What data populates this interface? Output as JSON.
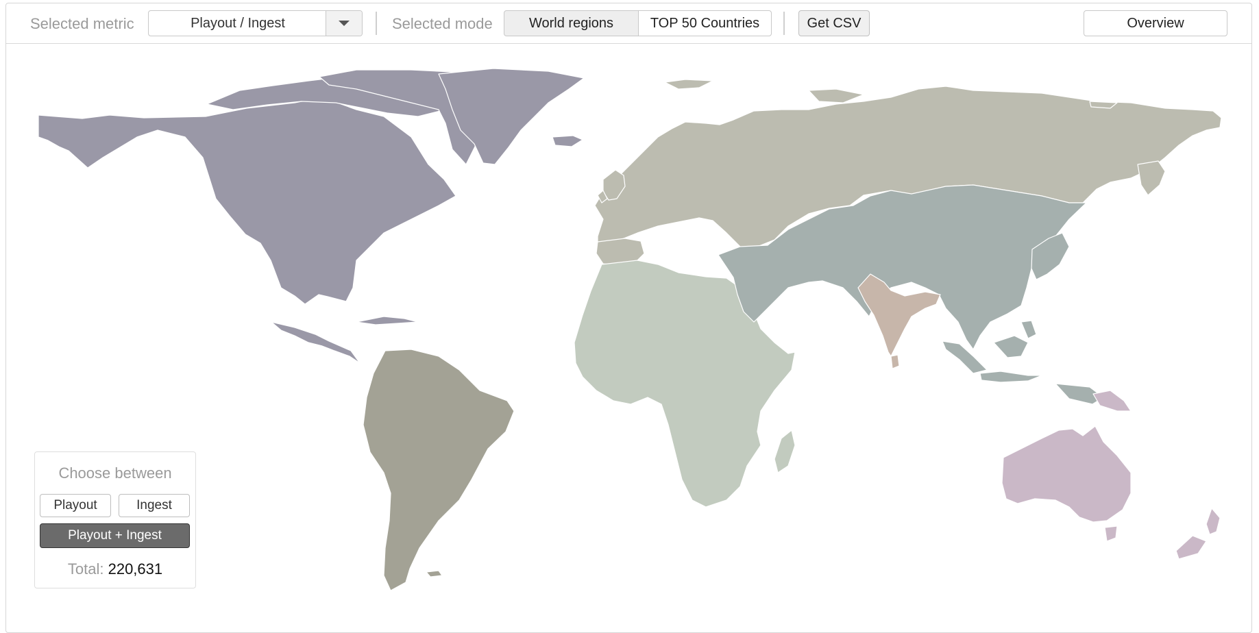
{
  "toolbar": {
    "metric_label": "Selected metric",
    "metric_value": "Playout / Ingest",
    "mode_label": "Selected mode",
    "mode_options": [
      "World regions",
      "TOP 50 Countries"
    ],
    "mode_selected": "World regions",
    "csv_label": "Get CSV",
    "overview_label": "Overview"
  },
  "chooser": {
    "title": "Choose between",
    "options": [
      "Playout",
      "Ingest",
      "Playout + Ingest"
    ],
    "selected": "Playout + Ingest",
    "total_label": "Total:",
    "total_value": "220,631"
  },
  "map": {
    "regions": [
      {
        "id": "north-america",
        "color": "#9a98a7"
      },
      {
        "id": "south-america",
        "color": "#a3a295"
      },
      {
        "id": "europe-russia",
        "color": "#bcbcb0"
      },
      {
        "id": "africa",
        "color": "#c2cbbf"
      },
      {
        "id": "asia",
        "color": "#a5b0ae"
      },
      {
        "id": "india",
        "color": "#c7b6aa"
      },
      {
        "id": "oceania",
        "color": "#cab8c7"
      }
    ]
  }
}
